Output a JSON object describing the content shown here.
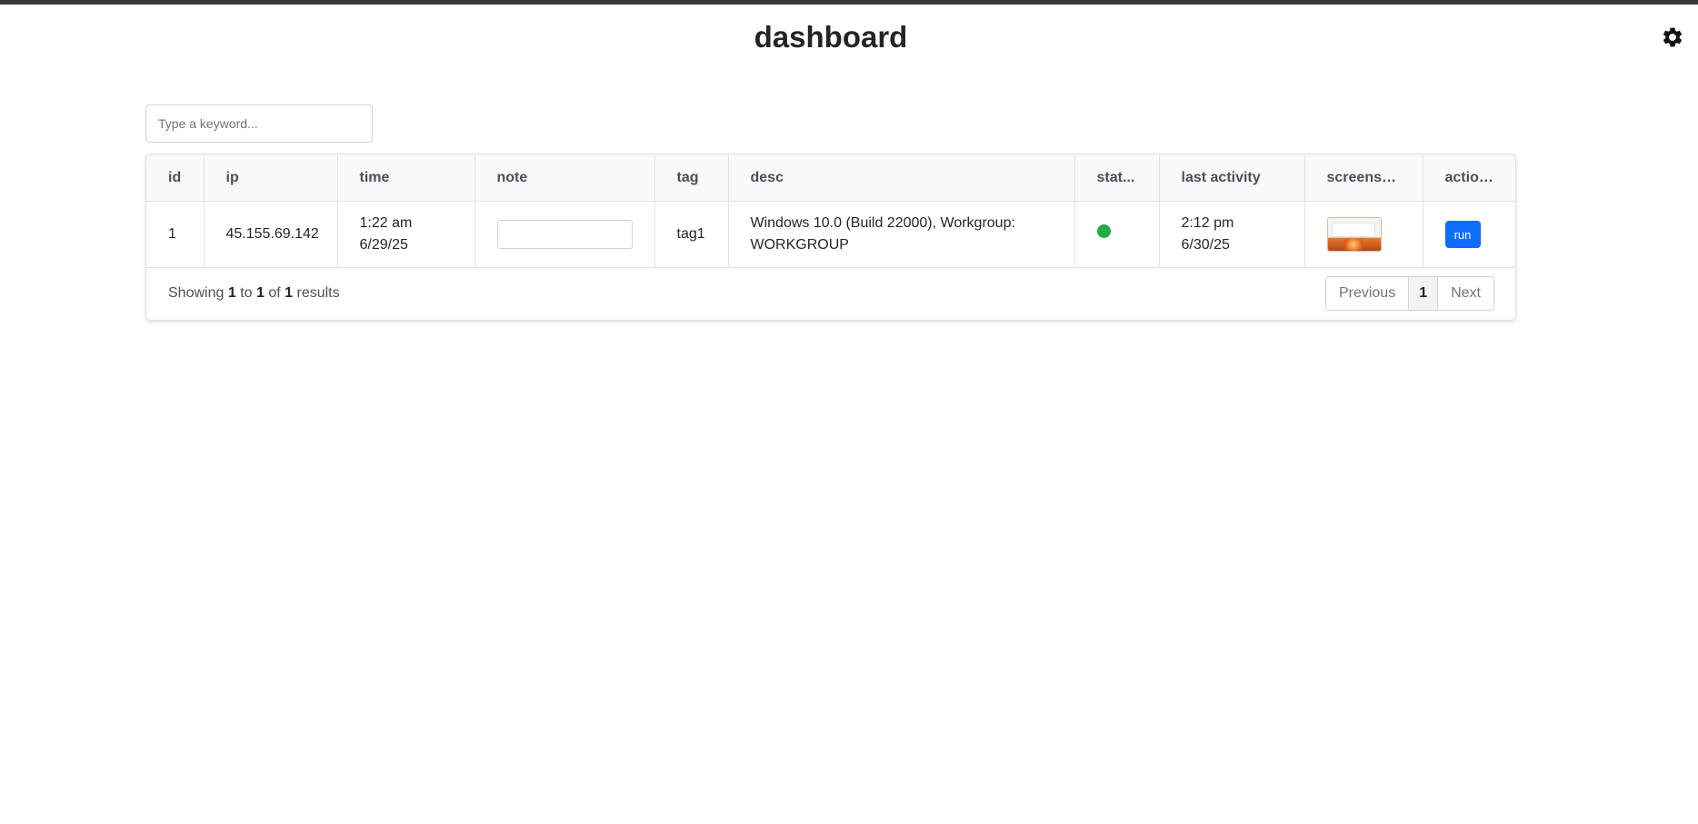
{
  "page": {
    "title": "dashboard",
    "settings_icon": "gear-icon"
  },
  "search": {
    "placeholder": "Type a keyword..."
  },
  "table": {
    "headers": [
      "id",
      "ip",
      "time",
      "note",
      "tag",
      "desc",
      "stat...",
      "last activity",
      "screenshot",
      "actions"
    ],
    "rows": [
      {
        "id": "1",
        "ip": "45.155.69.142",
        "time_line1": "1:22 am",
        "time_line2": "6/29/25",
        "note": "",
        "tag": "tag1",
        "desc_line1": "Windows 10.0 (Build 22000), Workgroup:",
        "desc_line2": "WORKGROUP",
        "status_color": "#28a745",
        "last_activity_line1": "2:12 pm",
        "last_activity_line2": "6/30/25",
        "action_label": "run"
      }
    ]
  },
  "footer": {
    "showing_prefix": "Showing",
    "from": "1",
    "to_word": "to",
    "to": "1",
    "of_word": "of",
    "total": "1",
    "results_word": "results"
  },
  "pagination": {
    "previous": "Previous",
    "current": "1",
    "next": "Next"
  },
  "colors": {
    "accent": "#0d6efd",
    "status_online": "#28a745",
    "topbar": "#343a40"
  }
}
